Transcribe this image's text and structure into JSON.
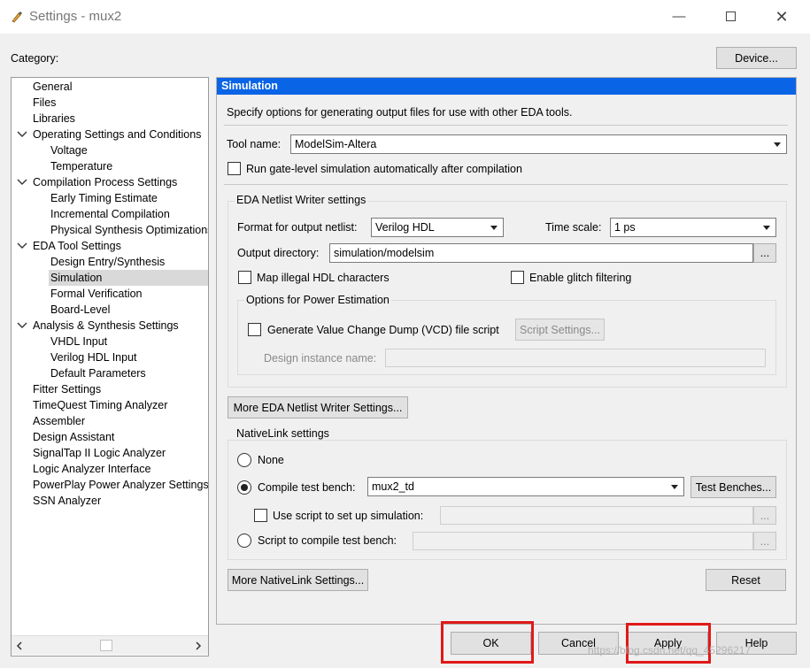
{
  "window": {
    "title": "Settings - mux2"
  },
  "category_label": "Category:",
  "device_button": "Device...",
  "tree": [
    {
      "label": "General",
      "level": 0,
      "expanded": false,
      "selected": false
    },
    {
      "label": "Files",
      "level": 0,
      "expanded": false,
      "selected": false
    },
    {
      "label": "Libraries",
      "level": 0,
      "expanded": false,
      "selected": false
    },
    {
      "label": "Operating Settings and Conditions",
      "level": 0,
      "expanded": true,
      "selected": false
    },
    {
      "label": "Voltage",
      "level": 1,
      "expanded": false,
      "selected": false
    },
    {
      "label": "Temperature",
      "level": 1,
      "expanded": false,
      "selected": false
    },
    {
      "label": "Compilation Process Settings",
      "level": 0,
      "expanded": true,
      "selected": false
    },
    {
      "label": "Early Timing Estimate",
      "level": 1,
      "expanded": false,
      "selected": false
    },
    {
      "label": "Incremental Compilation",
      "level": 1,
      "expanded": false,
      "selected": false
    },
    {
      "label": "Physical Synthesis Optimizations",
      "level": 1,
      "expanded": false,
      "selected": false
    },
    {
      "label": "EDA Tool Settings",
      "level": 0,
      "expanded": true,
      "selected": false
    },
    {
      "label": "Design Entry/Synthesis",
      "level": 1,
      "expanded": false,
      "selected": false
    },
    {
      "label": "Simulation",
      "level": 1,
      "expanded": false,
      "selected": true
    },
    {
      "label": "Formal Verification",
      "level": 1,
      "expanded": false,
      "selected": false
    },
    {
      "label": "Board-Level",
      "level": 1,
      "expanded": false,
      "selected": false
    },
    {
      "label": "Analysis & Synthesis Settings",
      "level": 0,
      "expanded": true,
      "selected": false
    },
    {
      "label": "VHDL Input",
      "level": 1,
      "expanded": false,
      "selected": false
    },
    {
      "label": "Verilog HDL Input",
      "level": 1,
      "expanded": false,
      "selected": false
    },
    {
      "label": "Default Parameters",
      "level": 1,
      "expanded": false,
      "selected": false
    },
    {
      "label": "Fitter Settings",
      "level": 0,
      "expanded": false,
      "selected": false
    },
    {
      "label": "TimeQuest Timing Analyzer",
      "level": 0,
      "expanded": false,
      "selected": false
    },
    {
      "label": "Assembler",
      "level": 0,
      "expanded": false,
      "selected": false
    },
    {
      "label": "Design Assistant",
      "level": 0,
      "expanded": false,
      "selected": false
    },
    {
      "label": "SignalTap II Logic Analyzer",
      "level": 0,
      "expanded": false,
      "selected": false
    },
    {
      "label": "Logic Analyzer Interface",
      "level": 0,
      "expanded": false,
      "selected": false
    },
    {
      "label": "PowerPlay Power Analyzer Settings",
      "level": 0,
      "expanded": false,
      "selected": false
    },
    {
      "label": "SSN Analyzer",
      "level": 0,
      "expanded": false,
      "selected": false
    }
  ],
  "simulation": {
    "header": "Simulation",
    "description": "Specify options for generating output files for use with other EDA tools.",
    "tool_name_label": "Tool name:",
    "tool_name_value": "ModelSim-Altera",
    "run_gate_level_label": "Run gate-level simulation automatically after compilation",
    "run_gate_level_checked": false,
    "eda_netlist": {
      "group_label": "EDA Netlist Writer settings",
      "format_label": "Format for output netlist:",
      "format_value": "Verilog HDL",
      "timescale_label": "Time scale:",
      "timescale_value": "1 ps",
      "output_dir_label": "Output directory:",
      "output_dir_value": "simulation/modelsim",
      "browse_label": "...",
      "map_illegal_label": "Map illegal HDL characters",
      "map_illegal_checked": false,
      "glitch_label": "Enable glitch filtering",
      "glitch_checked": false,
      "power": {
        "group_label": "Options for Power Estimation",
        "vcd_label": "Generate Value Change Dump (VCD) file script",
        "vcd_checked": false,
        "script_settings_label": "Script Settings...",
        "design_instance_label": "Design instance name:",
        "design_instance_value": ""
      },
      "more_button": "More EDA Netlist Writer Settings..."
    },
    "nativelink": {
      "group_label": "NativeLink settings",
      "none_label": "None",
      "compile_tb_label": "Compile test bench:",
      "compile_tb_value": "mux2_td",
      "test_benches_button": "Test Benches...",
      "use_script_label": "Use script to set up simulation:",
      "use_script_checked": false,
      "use_script_value": "",
      "script_compile_label": "Script to compile test bench:",
      "script_compile_value": "",
      "browse_label": "...",
      "selected": "compile_tb",
      "more_button": "More NativeLink Settings...",
      "reset_button": "Reset"
    }
  },
  "footer": {
    "ok": "OK",
    "cancel": "Cancel",
    "apply": "Apply",
    "help": "Help"
  },
  "watermark": "https://blog.csdn.net/qq_45296217",
  "colors": {
    "header_blue": "#0a64e6",
    "highlight_red": "#e01919",
    "selection_gray": "#d9d9d9"
  }
}
